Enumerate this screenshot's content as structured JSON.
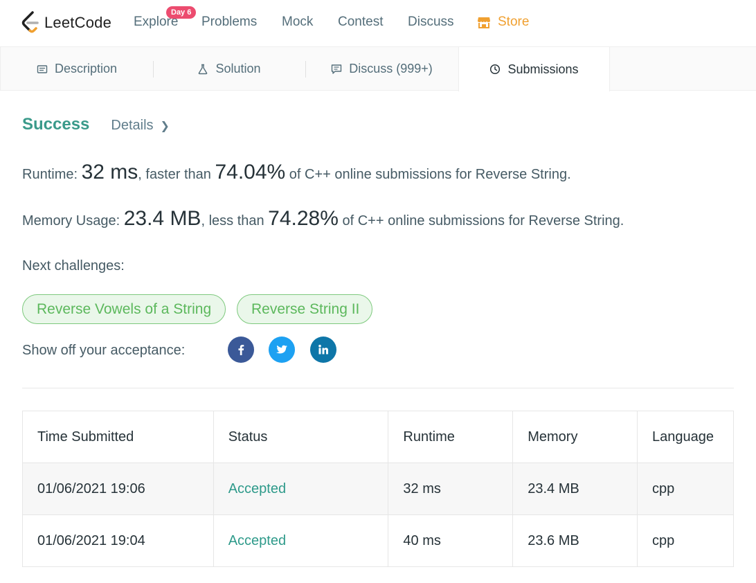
{
  "nav": {
    "logo_text": "LeetCode",
    "explore": "Explore",
    "explore_badge": "Day 6",
    "problems": "Problems",
    "mock": "Mock",
    "contest": "Contest",
    "discuss": "Discuss",
    "store": "Store",
    "store_color": "#f0a030"
  },
  "tabs": {
    "description": "Description",
    "solution": "Solution",
    "discuss": "Discuss (999+)",
    "submissions": "Submissions"
  },
  "result": {
    "status": "Success",
    "details": "Details",
    "status_color": "#3a9a8a",
    "runtime_label": "Runtime: ",
    "runtime_value": "32 ms",
    "runtime_mid": ", faster than ",
    "runtime_percent": "74.04%",
    "runtime_tail": " of C++ online submissions for Reverse String.",
    "memory_label": "Memory Usage: ",
    "memory_value": "23.4 MB",
    "memory_mid": ", less than ",
    "memory_percent": "74.28%",
    "memory_tail": " of C++ online submissions for Reverse String."
  },
  "next": {
    "label": "Next challenges:",
    "challenges": [
      "Reverse Vowels of a String",
      "Reverse String II"
    ]
  },
  "share": {
    "label": "Show off your acceptance:",
    "icons": [
      "facebook-icon",
      "twitter-icon",
      "linkedin-icon"
    ]
  },
  "table": {
    "headers": [
      "Time Submitted",
      "Status",
      "Runtime",
      "Memory",
      "Language"
    ],
    "rows": [
      [
        "01/06/2021 19:06",
        "Accepted",
        "32 ms",
        "23.4 MB",
        "cpp"
      ],
      [
        "01/06/2021 19:04",
        "Accepted",
        "40 ms",
        "23.6 MB",
        "cpp"
      ]
    ]
  }
}
